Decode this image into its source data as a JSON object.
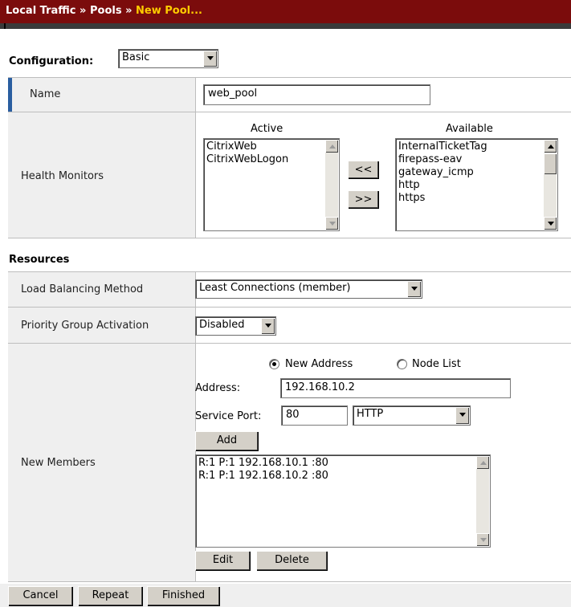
{
  "breadcrumb": {
    "part1": "Local Traffic",
    "sep1": "»",
    "part2": "Pools",
    "sep2": "»",
    "current": "New Pool..."
  },
  "configuration": {
    "label": "Configuration:",
    "mode": "Basic"
  },
  "name_row": {
    "label": "Name",
    "value": "web_pool"
  },
  "health_monitors": {
    "label": "Health Monitors",
    "active_header": "Active",
    "available_header": "Available",
    "active": [
      "CitrixWeb",
      "CitrixWebLogon"
    ],
    "available": [
      "InternalTicketTag",
      "firepass-eav",
      "gateway_icmp",
      "http",
      "https"
    ],
    "move_left": "<<",
    "move_right": ">>"
  },
  "resources": {
    "heading": "Resources",
    "lb_method": {
      "label": "Load Balancing Method",
      "value": "Least Connections (member)"
    },
    "priority": {
      "label": "Priority Group Activation",
      "value": "Disabled"
    },
    "new_members": {
      "label": "New Members",
      "radio_new_address": "New Address",
      "radio_node_list": "Node List",
      "address_label": "Address:",
      "address_value": "192.168.10.2",
      "port_label": "Service Port:",
      "port_value": "80",
      "service_value": "HTTP",
      "add_button": "Add",
      "members": [
        "R:1 P:1 192.168.10.1 :80",
        "R:1 P:1 192.168.10.2 :80"
      ],
      "edit_button": "Edit",
      "delete_button": "Delete"
    }
  },
  "footer": {
    "cancel": "Cancel",
    "repeat": "Repeat",
    "finished": "Finished"
  }
}
